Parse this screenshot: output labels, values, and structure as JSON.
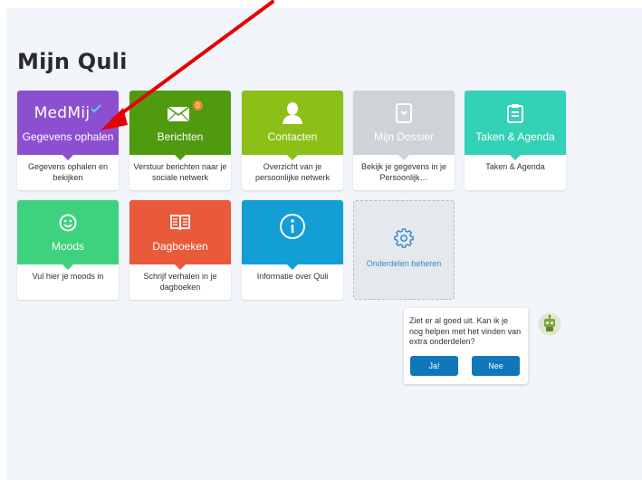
{
  "page": {
    "title": "Mijn Quli"
  },
  "tiles": [
    {
      "label": "Gegevens ophalen",
      "logo": "MedMij",
      "desc": "Gegevens ophalen en bekijken",
      "color": "#8c4fcf",
      "icon": "medmij-logo"
    },
    {
      "label": "Berichten",
      "badge": "0",
      "desc": "Verstuur berichten naar je sociale netwerk",
      "color": "#4f9a0f",
      "icon": "envelope-icon"
    },
    {
      "label": "Contacten",
      "desc": "Overzicht van je persoonlijke netwerk",
      "color": "#8cbf17",
      "icon": "person-icon"
    },
    {
      "label": "Mijn Dossier",
      "desc": "Bekijk je gegevens in je Persoonlijk…",
      "color": "#cfd2d6",
      "icon": "dossier-icon"
    },
    {
      "label": "Taken & Agenda",
      "desc": "Taken & Agenda",
      "color": "#33d1b6",
      "icon": "clipboard-icon"
    },
    {
      "label": "Moods",
      "desc": "Vul hier je moods in",
      "color": "#3ed27e",
      "icon": "smiley-icon"
    },
    {
      "label": "Dagboeken",
      "desc": "Schrijf verhalen in je dagboeken",
      "color": "#e85a3a",
      "icon": "book-icon"
    },
    {
      "label": "",
      "desc": "Informatie over Quli",
      "color": "#139ed6",
      "icon": "info-icon"
    }
  ],
  "manage": {
    "label": "Onderdelen beheren",
    "icon": "gear-icon"
  },
  "bot": {
    "message": "Ziet er al goed uit. Kan ik je nog helpen met het vinden van extra onderdelen?",
    "yes_label": "Ja!",
    "no_label": "Nee",
    "icon": "robot-avatar-icon"
  },
  "annotation": {
    "color": "#e60000",
    "icon": "red-arrow"
  }
}
